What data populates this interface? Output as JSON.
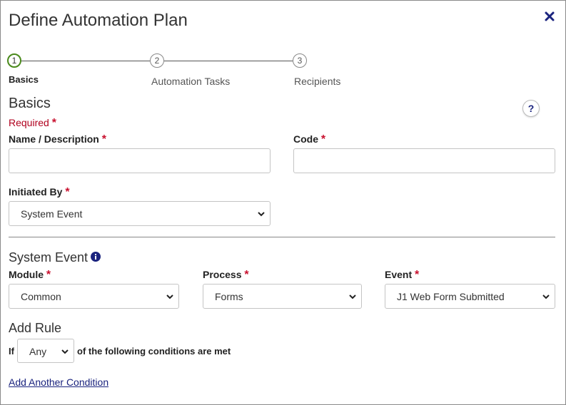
{
  "dialog": {
    "title": "Define Automation Plan",
    "close_icon": "close-icon"
  },
  "stepper": {
    "steps": [
      {
        "number": "1",
        "label": "Basics",
        "active": true
      },
      {
        "number": "2",
        "label": "Automation Tasks",
        "active": false
      },
      {
        "number": "3",
        "label": "Recipients",
        "active": false
      }
    ]
  },
  "basics": {
    "heading": "Basics",
    "required_note": "Required",
    "help_label": "?",
    "name": {
      "label": "Name / Description",
      "value": ""
    },
    "code": {
      "label": "Code",
      "value": ""
    },
    "initiated_by": {
      "label": "Initiated By",
      "value": "System Event"
    }
  },
  "system_event": {
    "heading": "System Event",
    "module": {
      "label": "Module",
      "value": "Common"
    },
    "process": {
      "label": "Process",
      "value": "Forms"
    },
    "event": {
      "label": "Event",
      "value": "J1 Web Form Submitted"
    }
  },
  "add_rule": {
    "heading": "Add Rule",
    "if_label": "If",
    "match_value": "Any",
    "conditions_text": "of the following conditions are met",
    "add_condition_link": "Add Another Condition"
  },
  "colors": {
    "required": "#c8102e",
    "active_step": "#4a8a1c",
    "link": "#1a237e"
  }
}
